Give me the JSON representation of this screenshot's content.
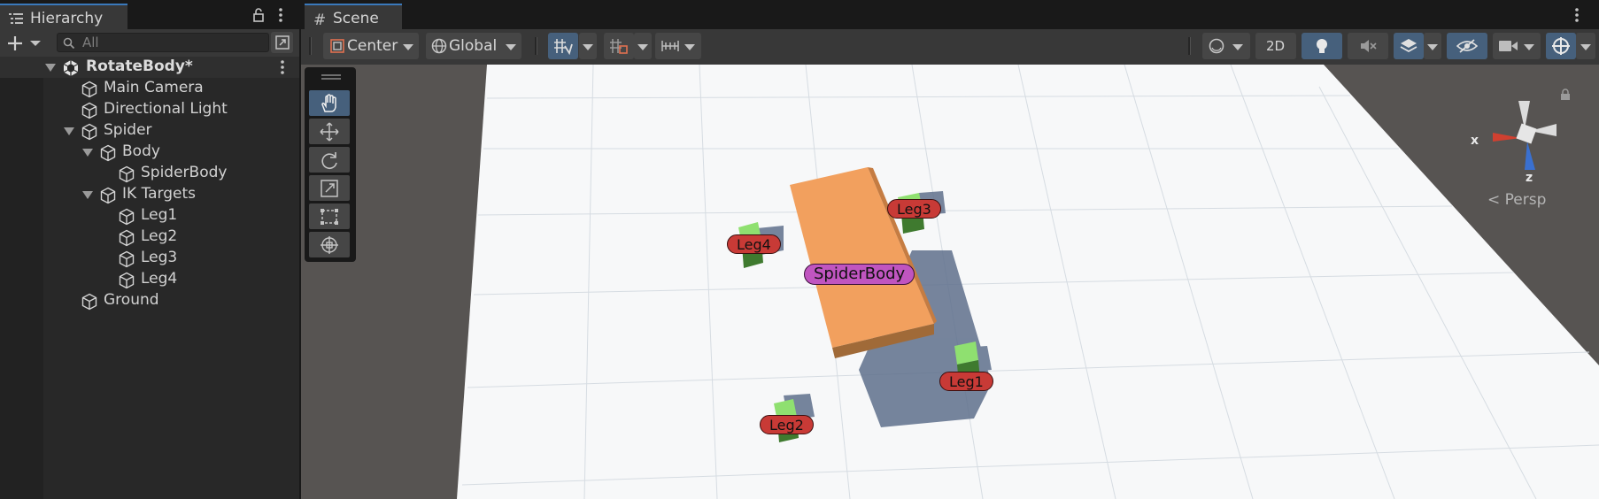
{
  "hierarchy": {
    "tab_label": "Hierarchy",
    "search_placeholder": "All",
    "items": [
      {
        "label": "RotateBody*"
      },
      {
        "label": "Main Camera"
      },
      {
        "label": "Directional Light"
      },
      {
        "label": "Spider"
      },
      {
        "label": "Body"
      },
      {
        "label": "SpiderBody"
      },
      {
        "label": "IK Targets"
      },
      {
        "label": "Leg1"
      },
      {
        "label": "Leg2"
      },
      {
        "label": "Leg3"
      },
      {
        "label": "Leg4"
      },
      {
        "label": "Ground"
      }
    ]
  },
  "scene": {
    "tab_label": "Scene",
    "toolbar": {
      "pivot_label": "Center",
      "space_label": "Global",
      "mode_2d_label": "2D"
    },
    "labels": {
      "leg1": "Leg1",
      "leg2": "Leg2",
      "leg3": "Leg3",
      "leg4": "Leg4",
      "spider_body": "SpiderBody"
    },
    "gizmo": {
      "x_label": "x",
      "z_label": "z",
      "projection_label": "< Persp"
    }
  },
  "colors": {
    "accent": "#3a79bb",
    "active_button": "#46607c",
    "leg_label": "#c83a36",
    "body_label": "#c055c0",
    "body_cube": "#f2a05e"
  }
}
